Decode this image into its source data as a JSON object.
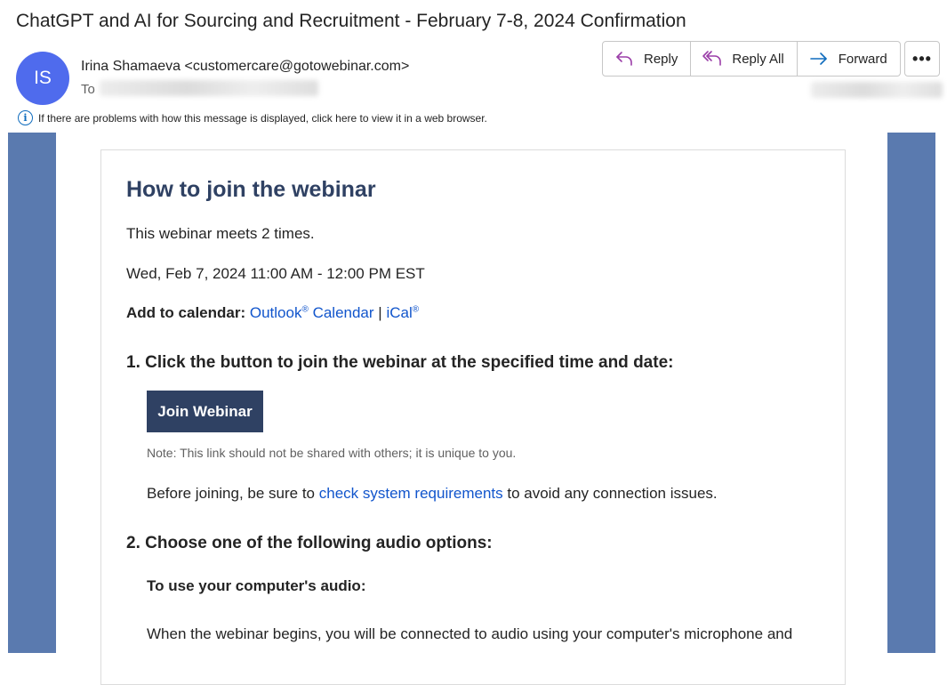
{
  "email": {
    "subject": "ChatGPT and AI for Sourcing and Recruitment - February 7-8, 2024 Confirmation",
    "avatar_initials": "IS",
    "sender": "Irina Shamaeva <customercare@gotowebinar.com>",
    "to_label": "To",
    "actions": {
      "reply": "Reply",
      "reply_all": "Reply All",
      "forward": "Forward",
      "more": "•••"
    },
    "info_bar": "If there are problems with how this message is displayed, click here to view it in a web browser."
  },
  "body": {
    "heading": "How to join the webinar",
    "meets": "This webinar meets 2 times.",
    "datetime": "Wed, Feb 7, 2024 11:00 AM - 12:00 PM EST",
    "add_to_calendar": {
      "label": "Add to calendar:",
      "outlook": "Outlook",
      "reg": "®",
      "calendar": "Calendar",
      "separator": "|",
      "ical": "iCal"
    },
    "step1": "1. Click the button to join the webinar at the specified time and date:",
    "join_button": "Join Webinar",
    "note": "Note: This link should not be shared with others; it is unique to you.",
    "before_joining": {
      "pre": "Before joining, be sure to ",
      "link": "check system requirements",
      "post": " to avoid any connection issues."
    },
    "step2": "2. Choose one of the following audio options:",
    "computer_audio_heading": "To use your computer's audio:",
    "computer_audio_text": "When the webinar begins, you will be connected to audio using your computer's microphone and"
  },
  "colors": {
    "avatar": "#4f6bed",
    "frame": "#5a7aaf",
    "heading": "#2f4163",
    "button": "#2f4163",
    "link": "#1155cc",
    "reply_icon": "#9b3ea8",
    "forward_icon": "#0f6cbd"
  }
}
